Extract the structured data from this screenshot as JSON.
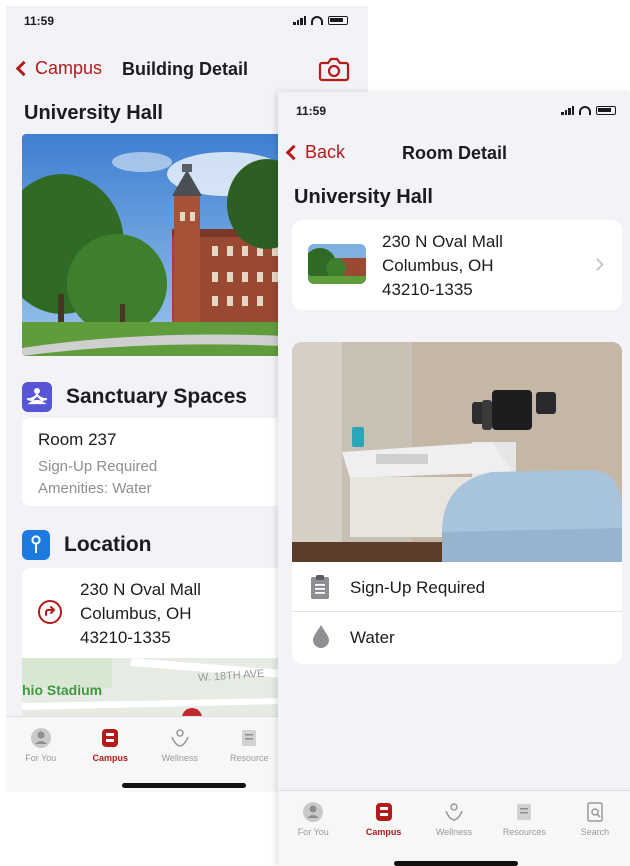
{
  "back_screen": {
    "status_time": "11:59",
    "back_label": "Campus",
    "nav_title": "Building Detail",
    "building_name": "University Hall",
    "sanctuary": {
      "title": "Sanctuary Spaces",
      "room": "Room 237",
      "signup": "Sign-Up Required",
      "amenities": "Amenities: Water"
    },
    "location": {
      "title": "Location",
      "address_line1": "230 N Oval Mall",
      "address_line2": "Columbus, OH",
      "address_line3": "43210-1335"
    },
    "map": {
      "label_stadium": "hio Stadium",
      "label_street": "W. 18TH AVE"
    },
    "tabs": [
      {
        "label": "For You"
      },
      {
        "label": "Campus"
      },
      {
        "label": "Wellness"
      },
      {
        "label": "Resource"
      }
    ]
  },
  "front_screen": {
    "status_time": "11:59",
    "back_label": "Back",
    "nav_title": "Room Detail",
    "building_name": "University Hall",
    "address_line1": "230 N Oval Mall",
    "address_line2": "Columbus, OH",
    "address_line3": "43210-1335",
    "details": [
      {
        "icon": "clipboard-icon",
        "label": "Sign-Up Required"
      },
      {
        "icon": "water-drop-icon",
        "label": "Water"
      }
    ],
    "tabs": [
      {
        "label": "For You"
      },
      {
        "label": "Campus"
      },
      {
        "label": "Wellness"
      },
      {
        "label": "Resources"
      },
      {
        "label": "Search"
      }
    ]
  },
  "colors": {
    "accent": "#b31b1b",
    "sanctuary_icon_bg": "#5856d6",
    "location_icon_bg": "#1f7ae0",
    "background": "#f2f2f7"
  }
}
